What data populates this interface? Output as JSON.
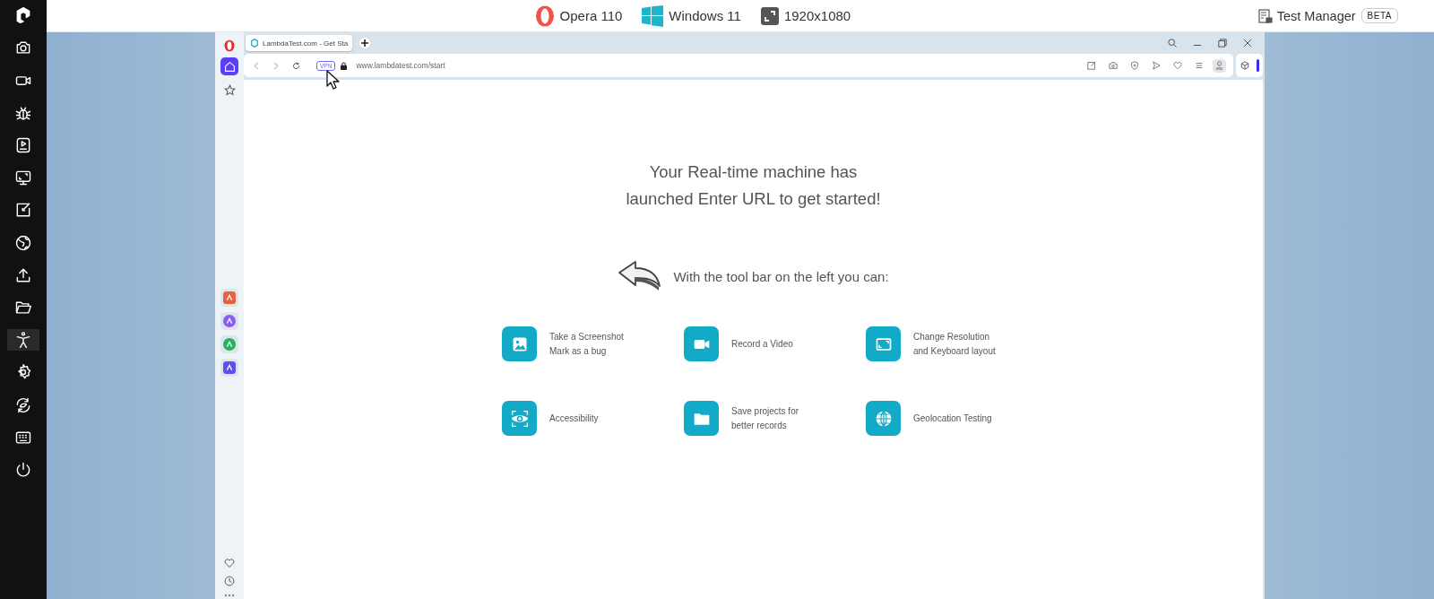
{
  "topbar": {
    "browser": "Opera 110",
    "os": "Windows 11",
    "resolution": "1920x1080",
    "test_manager": "Test Manager",
    "badge": "BETA"
  },
  "tools": [
    {
      "kind": "logo",
      "selected": false
    },
    {
      "kind": "camera",
      "selected": false
    },
    {
      "kind": "video",
      "selected": false
    },
    {
      "kind": "bug",
      "selected": false
    },
    {
      "kind": "player",
      "selected": false
    },
    {
      "kind": "monitor",
      "selected": false
    },
    {
      "kind": "resize",
      "selected": false
    },
    {
      "kind": "globe",
      "selected": false
    },
    {
      "kind": "upload",
      "selected": false
    },
    {
      "kind": "folder",
      "selected": false
    },
    {
      "kind": "person",
      "selected": true
    },
    {
      "kind": "gear",
      "selected": false
    },
    {
      "kind": "sync",
      "selected": false
    },
    {
      "kind": "keyboard",
      "selected": false
    },
    {
      "kind": "power",
      "selected": false
    }
  ],
  "browser": {
    "tab": {
      "title": "LambdaTest.com - Get Sta",
      "selected": true
    },
    "vpn": "VPN",
    "url": "www.lambdatest.com/start",
    "sidebar": [
      {
        "kind": "home",
        "selected": true
      },
      {
        "kind": "star",
        "selected": false
      }
    ],
    "apps": [
      {
        "kind": "aria",
        "color": "#e8603c"
      },
      {
        "kind": "messenger",
        "color": "#8a5cf6"
      },
      {
        "kind": "whatsapp",
        "color": "#25b35a"
      },
      {
        "kind": "music",
        "color": "#5b4ff0"
      }
    ]
  },
  "content": {
    "heading": [
      "Your Real-time machine has",
      "launched Enter URL to get started!"
    ],
    "subtitle": "With the tool bar on the left you can:",
    "features": [
      {
        "kind": "screenshot",
        "lines": [
          "Take a Screenshot",
          "Mark as a bug"
        ]
      },
      {
        "kind": "video",
        "lines": [
          "Record a Video"
        ]
      },
      {
        "kind": "resolution",
        "lines": [
          "Change Resolution",
          "and Keyboard layout"
        ]
      },
      {
        "kind": "accessibility",
        "lines": [
          "Accessibility"
        ]
      },
      {
        "kind": "folder",
        "lines": [
          "Save projects for",
          "better records"
        ]
      },
      {
        "kind": "globe",
        "lines": [
          "Geolocation Testing"
        ]
      }
    ]
  }
}
